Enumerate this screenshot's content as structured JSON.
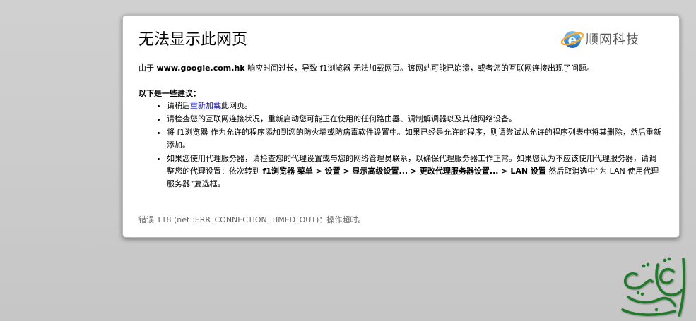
{
  "page": {
    "title": "无法显示此网页",
    "brand": "顺网科技",
    "message": {
      "pre": "由于 ",
      "host": "www.google.com.hk",
      "post": " 响应时间过长，导致 f1浏览器 无法加载网页。该网站可能已崩溃，或者您的互联网连接出现了问题。"
    },
    "suggestions_heading": "以下是一些建议：",
    "suggestions": {
      "s1_pre": "请稍后",
      "s1_link": "重新加载",
      "s1_post": "此网页。",
      "s2": "请检查您的互联网连接状况，重新启动您可能正在使用的任何路由器、调制解调器以及其他网络设备。",
      "s3": "将 f1浏览器 作为允许的程序添加到您的防火墙或防病毒软件设置中。如果已经是允许的程序，则请尝试从允许的程序列表中将其删除，然后重新添加。",
      "s4_pre": "如果您使用代理服务器，请检查您的代理设置或与您的网络管理员联系，以确保代理服务器工作正常。如果您认为不应该使用代理服务器，请调整您的代理设置：依次转到 ",
      "s4_path": "f1浏览器 菜单 > 设置 > 显示高级设置... > 更改代理服务器设置... > LAN 设置",
      "s4_post": " 然后取消选中“为 LAN 使用代理服务器”复选框。"
    },
    "error_code": "错误 118 (net::ERR_CONNECTION_TIMED_OUT)：操作超时。"
  },
  "colors": {
    "link": "#1a1aa6",
    "signature_green": "#1f7a2a"
  },
  "icons": {
    "brand": "ie-style-globe-icon",
    "bullet": "bullet-dot"
  }
}
